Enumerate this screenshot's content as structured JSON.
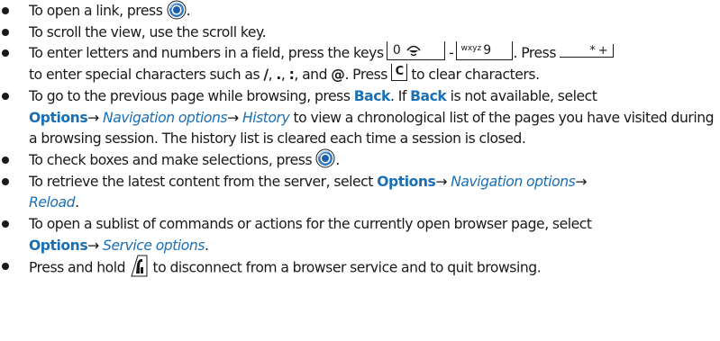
{
  "items": [
    {
      "text_a": "To open a link, press",
      "text_b": "."
    },
    {
      "text_a": "To scroll the view, use the scroll key."
    },
    {
      "text_a": "To enter letters and numbers in a field, press the keys",
      "key_zero": "0",
      "dash": "-",
      "key_wxyz_small": "wxyz",
      "key_wxyz_digit": "9",
      "text_b": ". Press",
      "key_star": "* +",
      "text_c": "to enter special characters such as",
      "sym_slash": "/",
      "sep_1": ",",
      "sym_dot": ".",
      "sep_2": ",",
      "sym_colon": ":",
      "sep_3": ", and",
      "sym_at": "@",
      "text_d": ". Press",
      "key_c": "C",
      "text_e": "to clear characters."
    },
    {
      "text_a": "To go to the previous page while browsing, press",
      "back_1": "Back",
      "text_b": ". If",
      "back_2": "Back",
      "text_c": "is not available, select",
      "options": "Options",
      "arrow_1": "→",
      "nav_options": "Navigation options",
      "arrow_2": "→",
      "history": "History",
      "text_d": "to view a chronological list of the pages you have visited during a browsing session. The history list is cleared each time a session is closed."
    },
    {
      "text_a": "To check boxes and make selections, press",
      "text_b": "."
    },
    {
      "text_a": "To retrieve the latest content from the server, select",
      "options": "Options",
      "arrow_1": "→",
      "nav_options": "Navigation options",
      "arrow_2": "→",
      "reload": "Reload",
      "text_b": "."
    },
    {
      "text_a": "To open a sublist of commands or actions for the currently open browser page, select",
      "options": "Options",
      "arrow_1": "→",
      "service_options": "Service options",
      "text_b": "."
    },
    {
      "text_a": "Press and hold",
      "text_b": "to disconnect from a browser service and to quit browsing."
    }
  ],
  "icons": {
    "scroll_key": "navi-key-press-icon",
    "end_key": "end-key-icon",
    "edit_icon": "key-zero-symbol-icon"
  },
  "colors": {
    "link": "#1b6fb5",
    "text": "#1a1a1a"
  }
}
